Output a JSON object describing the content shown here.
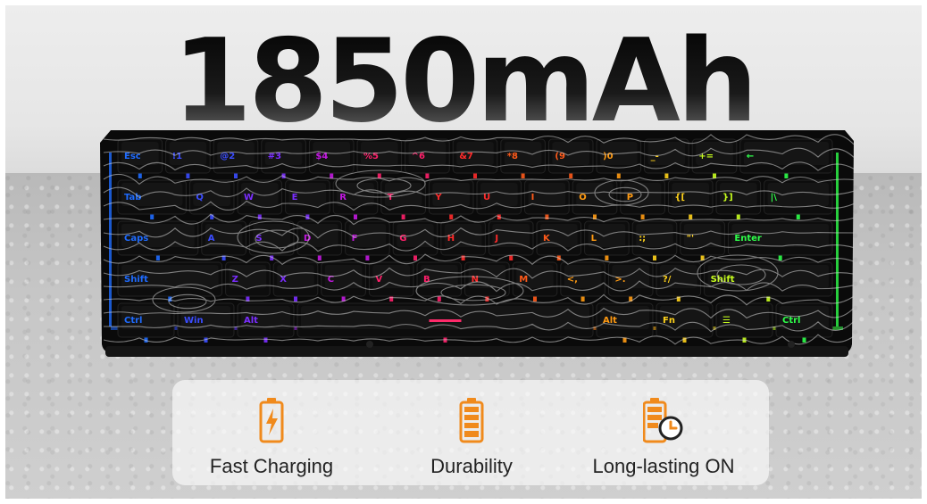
{
  "headline": "1850mAh",
  "features": [
    {
      "label": "Fast Charging",
      "icon": "battery-charging-icon"
    },
    {
      "label": "Durability",
      "icon": "battery-full-icon"
    },
    {
      "label": "Long-lasting ON",
      "icon": "battery-clock-icon"
    }
  ],
  "keyboard": {
    "rows": [
      [
        "Esc",
        "!1",
        "@2",
        "#3",
        "$4",
        "%5",
        "^6",
        "&7",
        "*8",
        "(9",
        ")0",
        "_-",
        "+=",
        "←"
      ],
      [
        "Tab",
        "Q",
        "W",
        "E",
        "R",
        "T",
        "Y",
        "U",
        "I",
        "O",
        "P",
        "{[",
        "}]",
        "|\\"
      ],
      [
        "Caps",
        "A",
        "S",
        "D",
        "F",
        "G",
        "H",
        "J",
        "K",
        "L",
        ":;",
        "\"'",
        "Enter"
      ],
      [
        "Shift",
        "Z",
        "X",
        "C",
        "V",
        "B",
        "N",
        "M",
        "<,",
        ">.",
        "?/",
        "Shift"
      ],
      [
        "Ctrl",
        "Win",
        "Alt",
        "",
        "Alt",
        "Fn",
        "☰",
        "Ctrl"
      ]
    ],
    "accent_colors": [
      "#1e6bff",
      "#3a4cff",
      "#7a2dff",
      "#c218e0",
      "#ff1f6a",
      "#ff2a2a",
      "#ff5a1a",
      "#ff9a12",
      "#ffd21a",
      "#c8ff1e",
      "#2eff4a"
    ]
  },
  "colors": {
    "accent": "#f08a1c",
    "keycap": "#0d0d0d"
  }
}
